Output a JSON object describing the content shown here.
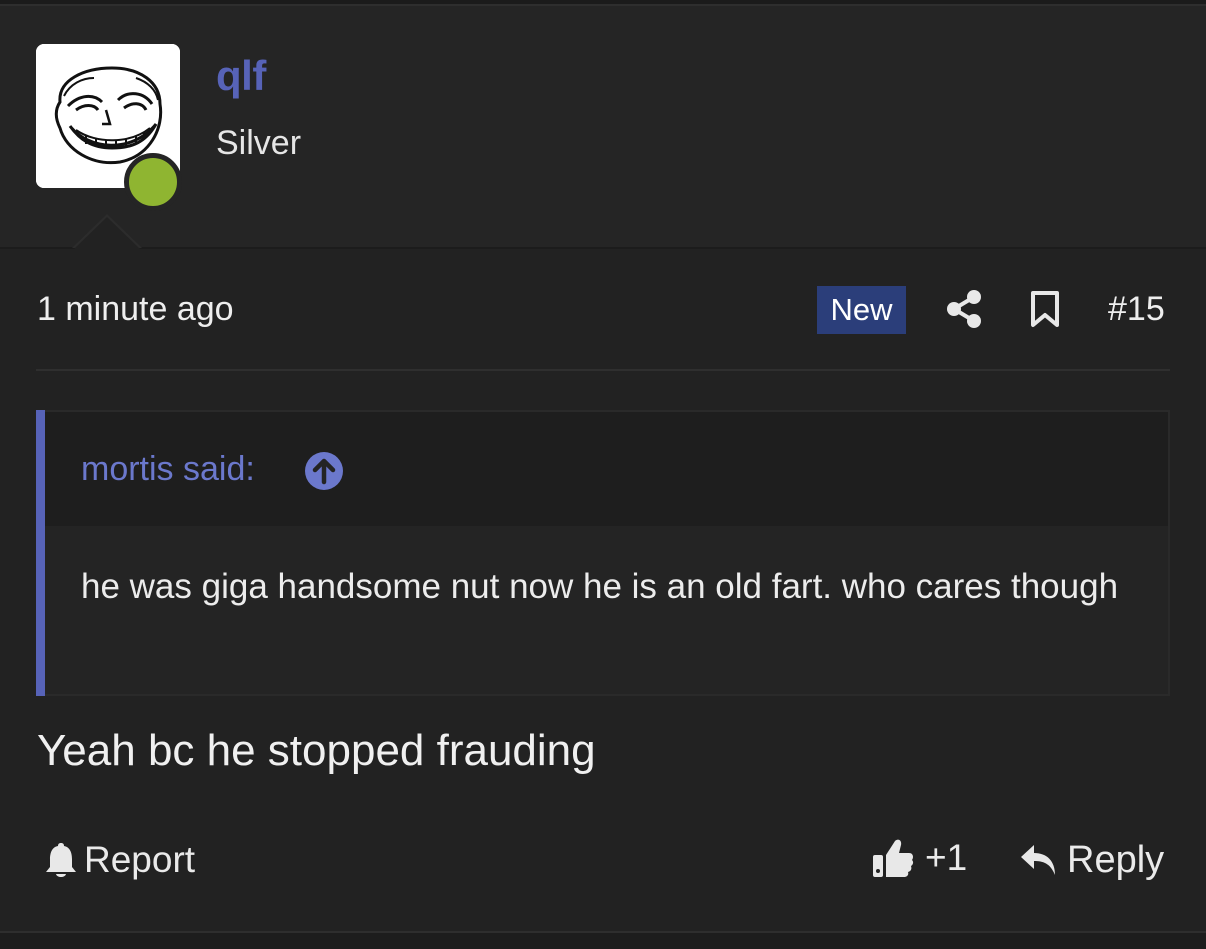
{
  "user": {
    "name": "qlf",
    "title": "Silver",
    "online": true
  },
  "post": {
    "timestamp": "1 minute ago",
    "badge": "New",
    "number": "#15",
    "quote": {
      "author": "mortis said:",
      "text": "he was giga handsome nut now he is an old fart. who cares though"
    },
    "message": "Yeah bc he stopped frauding"
  },
  "actions": {
    "report": "Report",
    "reactions": "+1",
    "reply": "Reply"
  },
  "icons": {
    "share": "share-icon",
    "bookmark": "bookmark-icon",
    "quote_jump": "arrow-up-circle-icon",
    "report": "bell-icon",
    "like": "thumbs-up-icon",
    "reply": "reply-arrow-icon"
  },
  "colors": {
    "background": "#222222",
    "accent": "#5763b8",
    "badge": "#2b3e7a",
    "online": "#8fb531"
  }
}
